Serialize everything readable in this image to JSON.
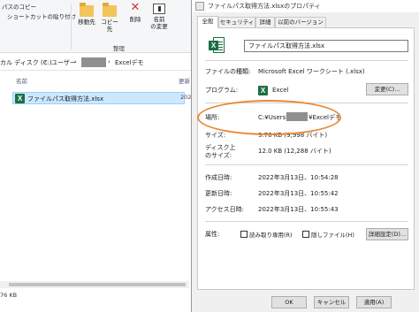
{
  "explorer": {
    "ribbon": {
      "copy_path_label": "パスのコピー",
      "paste_shortcut_label": "ショートカットの貼り付け",
      "move_to_label": "移動先",
      "copy_to_label": "コピー先",
      "delete_label": "削除",
      "rename_label_line1": "名前",
      "rename_label_line2": "の変更",
      "group_label": "整理"
    },
    "address": {
      "drive": "ローカル ディスク (C:)",
      "users": "ユーザー",
      "folder": "Excelデモ",
      "sep": "›"
    },
    "columns": {
      "name": "名前",
      "date": "更新"
    },
    "file": {
      "name": "ファイルパス取得方法.xlsx",
      "date_cut": "202"
    },
    "status_text": "76 KB"
  },
  "dialog": {
    "title": "ファイルパス取得方法.xlsxのプロパティ",
    "tabs": [
      "全般",
      "セキュリティ",
      "詳細",
      "以前のバージョン"
    ],
    "file_name": "ファイルパス取得方法.xlsx",
    "rows": {
      "type_label": "ファイルの種類:",
      "type_value": "Microsoft Excel ワークシート (.xlsx)",
      "program_label": "プログラム:",
      "program_value": "Excel",
      "change_button": "変更(C)...",
      "location_label": "場所:",
      "location_prefix": "C:¥Users¥",
      "location_suffix": "¥Excelデモ",
      "size_label": "サイズ:",
      "size_value": "9.76 KB (9,998 バイト)",
      "disk_size_label_1": "ディスク上",
      "disk_size_label_2": "のサイズ:",
      "disk_size_value": "12.0 KB (12,288 バイト)",
      "created_label": "作成日時:",
      "created_value": "2022年3月13日、10:54:28",
      "modified_label": "更新日時:",
      "modified_value": "2022年3月13日、10:55:42",
      "accessed_label": "アクセス日時:",
      "accessed_value": "2022年3月13日、10:55:43",
      "attributes_label": "属性:",
      "readonly_label": "読み取り専用(R)",
      "hidden_label": "隠しファイル(H)",
      "advanced_button": "詳細設定(D)..."
    },
    "footer": {
      "ok": "OK",
      "cancel": "キャンセル",
      "apply": "適用(A)"
    },
    "highlight_color": "#e88a35"
  }
}
